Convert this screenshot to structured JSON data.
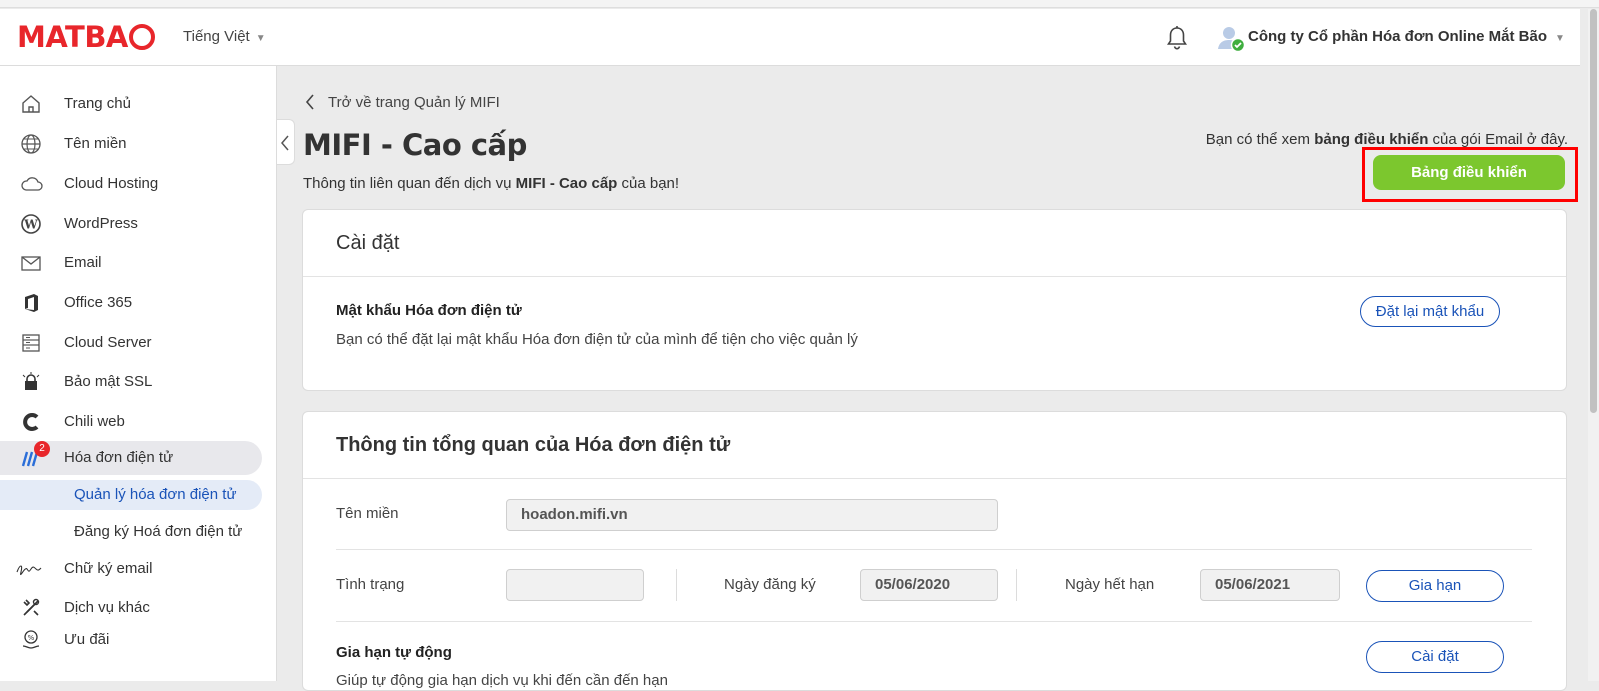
{
  "header": {
    "logo_text": "MATBAO",
    "logo_prefix": "MATBA",
    "language": "Tiếng Việt",
    "company": "Công ty Cổ phần Hóa đơn Online Mắt Bão"
  },
  "sidebar": {
    "items": [
      {
        "label": "Trang chủ",
        "icon": "home-icon"
      },
      {
        "label": "Tên miền",
        "icon": "globe-icon"
      },
      {
        "label": "Cloud Hosting",
        "icon": "cloud-icon"
      },
      {
        "label": "WordPress",
        "icon": "wordpress-icon"
      },
      {
        "label": "Email",
        "icon": "mail-icon"
      },
      {
        "label": "Office 365",
        "icon": "office-icon"
      },
      {
        "label": "Cloud Server",
        "icon": "server-icon"
      },
      {
        "label": "Bảo mật SSL",
        "icon": "ssl-lock-icon"
      },
      {
        "label": "Chili web",
        "icon": "chili-icon"
      },
      {
        "label": "Hóa đơn điện tử",
        "icon": "invoice-icon",
        "badge": "2"
      },
      {
        "label": "Chữ ký email",
        "icon": "signature-icon"
      },
      {
        "label": "Dịch vụ khác",
        "icon": "tools-icon"
      },
      {
        "label": "Ưu đãi",
        "icon": "discount-icon"
      }
    ],
    "sub_items": [
      {
        "label": "Quản lý hóa đơn điện tử"
      },
      {
        "label": "Đăng ký Hoá đơn điện tử"
      }
    ]
  },
  "main": {
    "back_link": "Trở về trang Quản lý MIFI",
    "title": "MIFI - Cao cấp",
    "subtitle_prefix": "Thông tin liên quan đến dịch vụ ",
    "subtitle_bold": "MIFI - Cao cấp",
    "subtitle_suffix": " của bạn!",
    "dash_note_prefix": "Bạn có thể xem ",
    "dash_note_bold": "bảng điều khiển",
    "dash_note_suffix": " của gói Email ở đây.",
    "dashboard_button": "Bảng điều khiển"
  },
  "settings_card": {
    "title": "Cài đặt",
    "password_title": "Mật khẩu Hóa đơn điện tử",
    "password_desc": "Bạn có thể đặt lại mật khẩu Hóa đơn điện tử của mình để tiện cho việc quản lý",
    "reset_button": "Đặt lại mật khẩu"
  },
  "overview_card": {
    "title": "Thông tin tổng quan của Hóa đơn điện tử",
    "domain_label": "Tên miền",
    "domain_value": "hoadon.mifi.vn",
    "status_label": "Tình trạng",
    "status_value": "",
    "reg_date_label": "Ngày đăng ký",
    "reg_date_value": "05/06/2020",
    "exp_date_label": "Ngày hết hạn",
    "exp_date_value": "05/06/2021",
    "renew_button": "Gia hạn",
    "auto_renew_label": "Gia hạn tự động",
    "auto_renew_desc": "Giúp tự động gia hạn dịch vụ khi đến cần đến hạn",
    "setup_button": "Cài đặt"
  },
  "colors": {
    "brand_red": "#e8262b",
    "accent_green": "#7cc72e",
    "link_blue": "#1a53b8",
    "highlight_red": "#ff0000"
  }
}
